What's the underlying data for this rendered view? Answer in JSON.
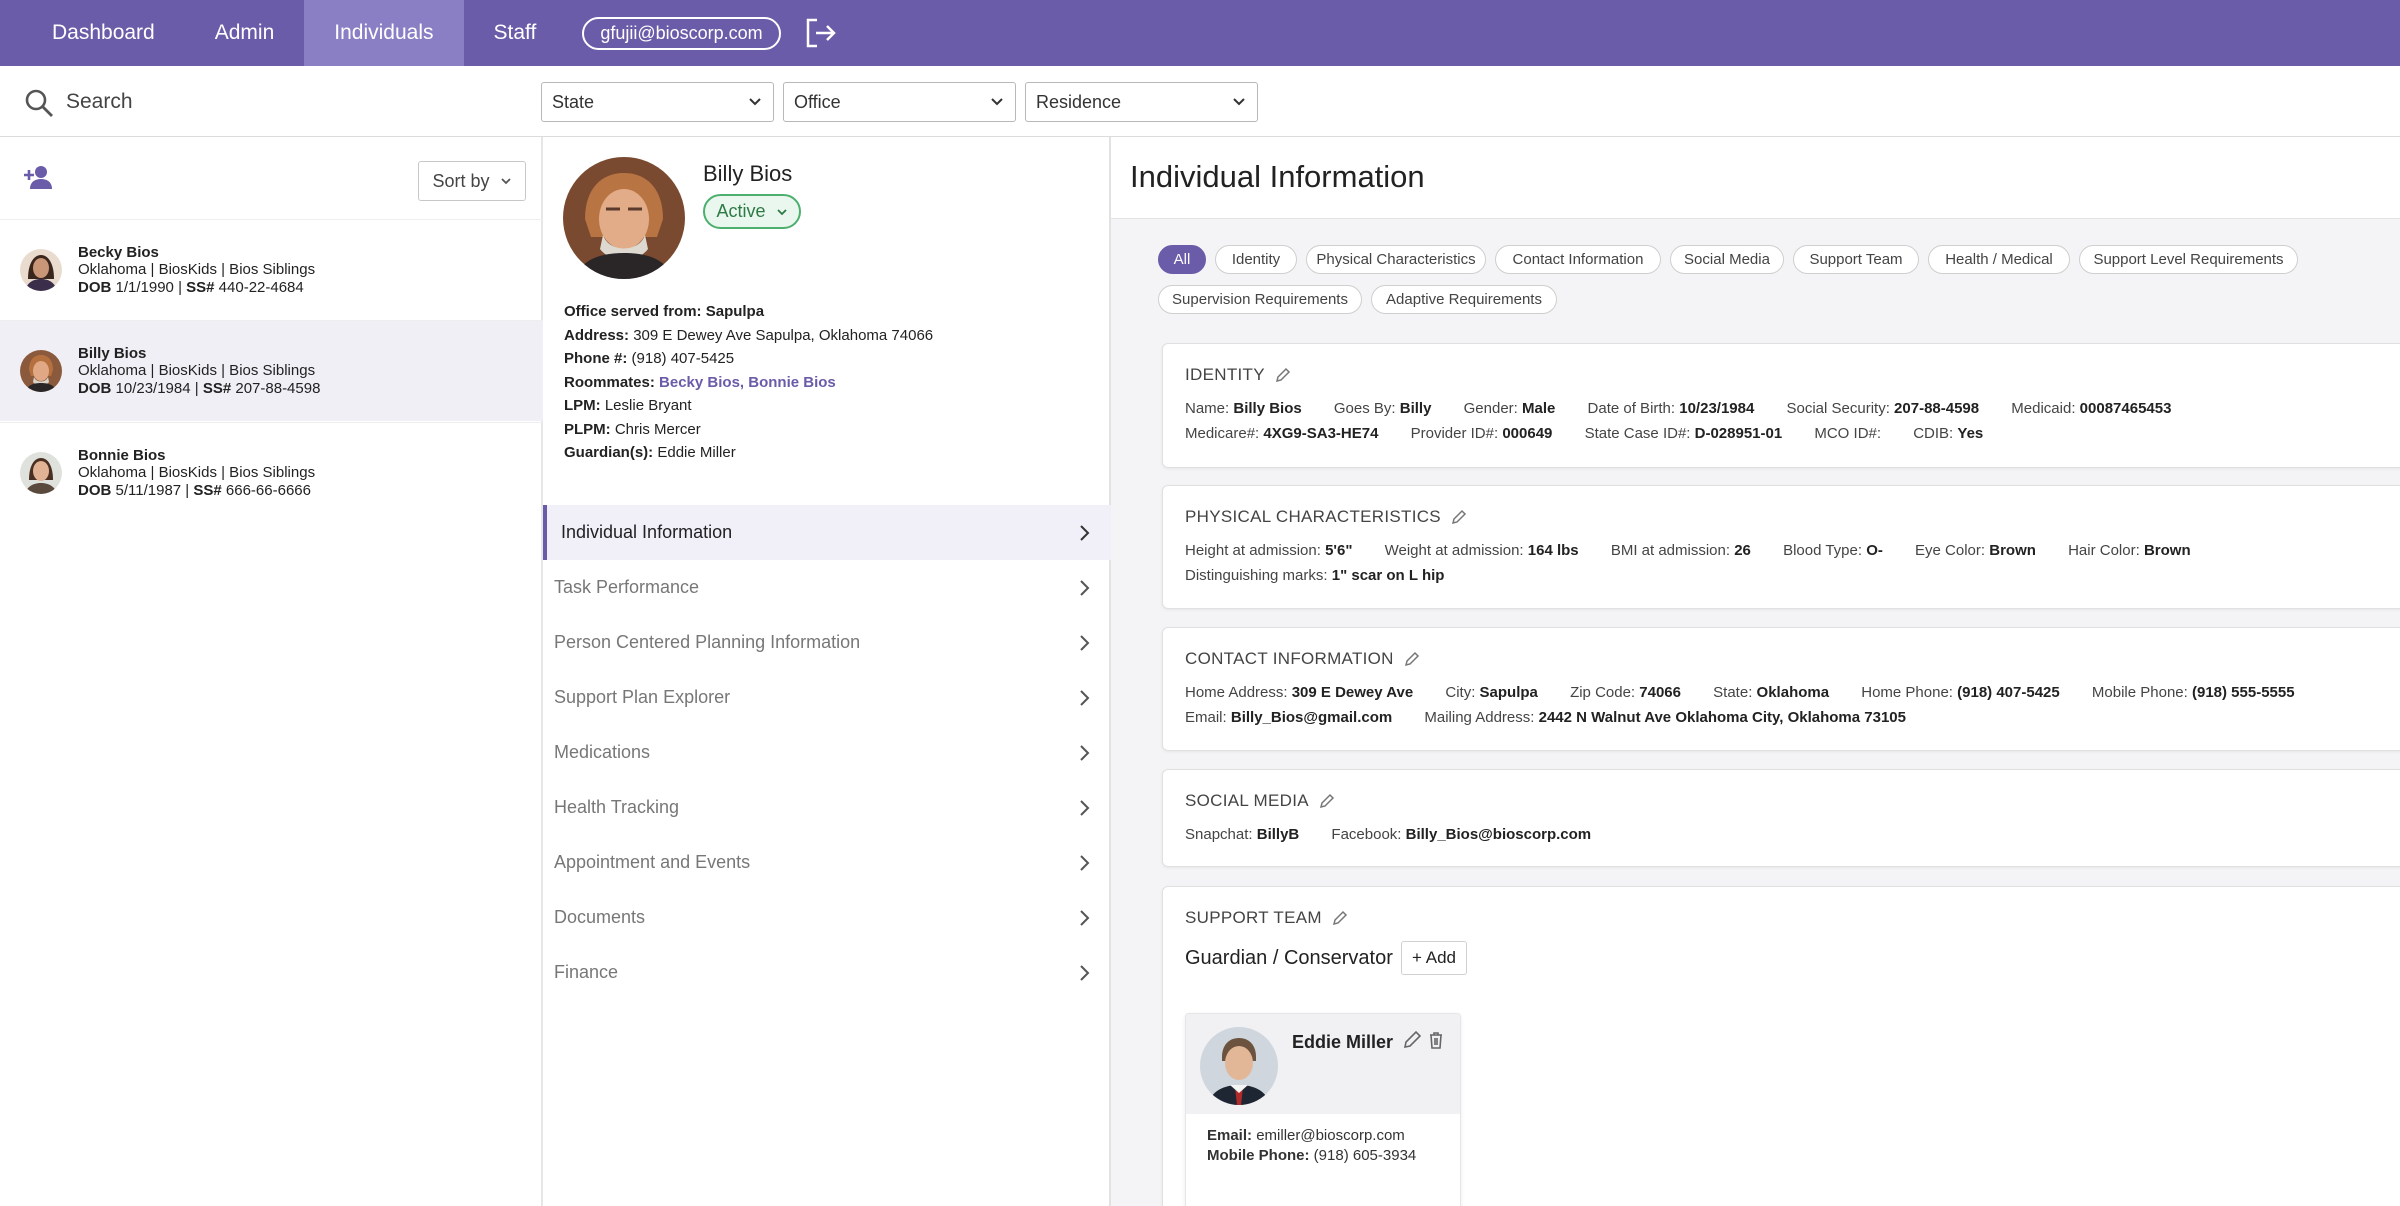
{
  "nav": {
    "tabs": [
      "Dashboard",
      "Admin",
      "Individuals",
      "Staff"
    ],
    "active": "Individuals",
    "user_email": "gfujii@bioscorp.com"
  },
  "search": {
    "placeholder": "Search",
    "filters": [
      "State",
      "Office",
      "Residence"
    ]
  },
  "list": {
    "sort_label": "Sort by",
    "people": [
      {
        "name": "Becky Bios",
        "meta": "Oklahoma | BiosKids | Bios Siblings",
        "dob_label": "DOB",
        "dob": "1/1/1990",
        "ss_label": "SS#",
        "ss": "440-22-4684"
      },
      {
        "name": "Billy Bios",
        "meta": "Oklahoma | BiosKids | Bios Siblings",
        "dob_label": "DOB",
        "dob": "10/23/1984",
        "ss_label": "SS#",
        "ss": "207-88-4598"
      },
      {
        "name": "Bonnie Bios",
        "meta": "Oklahoma | BiosKids | Bios Siblings",
        "dob_label": "DOB",
        "dob": "5/11/1987",
        "ss_label": "SS#",
        "ss": "666-66-6666"
      }
    ]
  },
  "profile": {
    "name": "Billy Bios",
    "status": "Active",
    "office_label": "Office served from:",
    "office": "Sapulpa",
    "address_label": "Address:",
    "address": "309 E Dewey Ave Sapulpa, Oklahoma 74066",
    "phone_label": "Phone #:",
    "phone": "(918) 407-5425",
    "roommates_label": "Roommates:",
    "roommate_1": "Becky Bios",
    "roommate_sep": ",",
    "roommate_2": "Bonnie Bios",
    "lpm_label": "LPM:",
    "lpm": "Leslie Bryant",
    "plpm_label": "PLPM:",
    "plpm": "Chris Mercer",
    "guardian_label": "Guardian(s):",
    "guardian": "Eddie Miller"
  },
  "menu": [
    "Individual Information",
    "Task Performance",
    "Person Centered Planning Information",
    "Support Plan Explorer",
    "Medications",
    "Health Tracking",
    "Appointment and Events",
    "Documents",
    "Finance"
  ],
  "info": {
    "title": "Individual Information",
    "chips": [
      "All",
      "Identity",
      "Physical Characteristics",
      "Contact Information",
      "Social Media",
      "Support Team",
      "Health / Medical",
      "Support Level Requirements",
      "Supervision Requirements",
      "Adaptive Requirements"
    ],
    "identity": {
      "title": "IDENTITY",
      "row1": [
        {
          "k": "Name:",
          "v": "Billy Bios"
        },
        {
          "k": "Goes By:",
          "v": "Billy"
        },
        {
          "k": "Gender:",
          "v": "Male"
        },
        {
          "k": "Date of Birth:",
          "v": "10/23/1984"
        },
        {
          "k": "Social Security:",
          "v": "207-88-4598"
        },
        {
          "k": "Medicaid:",
          "v": "00087465453"
        }
      ],
      "row2": [
        {
          "k": "Medicare#:",
          "v": "4XG9-SA3-HE74"
        },
        {
          "k": "Provider ID#:",
          "v": "000649"
        },
        {
          "k": "State Case ID#:",
          "v": "D-028951-01"
        },
        {
          "k": "MCO ID#:",
          "v": ""
        },
        {
          "k": "CDIB:",
          "v": "Yes"
        }
      ]
    },
    "physical": {
      "title": "PHYSICAL CHARACTERISTICS",
      "row1": [
        {
          "k": "Height at admission:",
          "v": "5'6\""
        },
        {
          "k": "Weight at admission:",
          "v": "164 lbs"
        },
        {
          "k": "BMI at admission:",
          "v": "26"
        },
        {
          "k": "Blood Type:",
          "v": "O-"
        },
        {
          "k": "Eye Color:",
          "v": "Brown"
        },
        {
          "k": "Hair Color:",
          "v": "Brown"
        }
      ],
      "row2": [
        {
          "k": "Distinguishing marks:",
          "v": "1\" scar on L hip"
        }
      ]
    },
    "contact": {
      "title": "CONTACT INFORMATION",
      "row1": [
        {
          "k": "Home Address:",
          "v": "309 E Dewey Ave"
        },
        {
          "k": "City:",
          "v": "Sapulpa"
        },
        {
          "k": "Zip Code:",
          "v": "74066"
        },
        {
          "k": "State:",
          "v": "Oklahoma"
        },
        {
          "k": "Home Phone:",
          "v": "(918) 407-5425"
        },
        {
          "k": "Mobile Phone:",
          "v": "(918) 555-5555"
        }
      ],
      "row2": [
        {
          "k": "Email:",
          "v": "Billy_Bios@gmail.com"
        },
        {
          "k": "Mailing Address:",
          "v": "2442 N Walnut Ave Oklahoma City, Oklahoma 73105"
        }
      ]
    },
    "social": {
      "title": "SOCIAL MEDIA",
      "row1": [
        {
          "k": "Snapchat:",
          "v": "BillyB"
        },
        {
          "k": "Facebook:",
          "v": "Billy_Bios@bioscorp.com"
        }
      ]
    },
    "support": {
      "title": "SUPPORT TEAM",
      "subhead": "Guardian / Conservator",
      "add_label": "+ Add",
      "member": {
        "name": "Eddie Miller",
        "email_label": "Email:",
        "email": "emiller@bioscorp.com",
        "phone_label": "Mobile Phone:",
        "phone": "(918) 605-3934"
      }
    }
  },
  "colors": {
    "brand": "#6a5ca8",
    "active_tab": "#8a7fc4",
    "status_green": "#4caf6e"
  },
  "icons": [
    "search-icon",
    "logout-icon",
    "add-person-icon",
    "chevron-down-icon",
    "chevron-right-icon",
    "pencil-icon",
    "trash-icon"
  ]
}
